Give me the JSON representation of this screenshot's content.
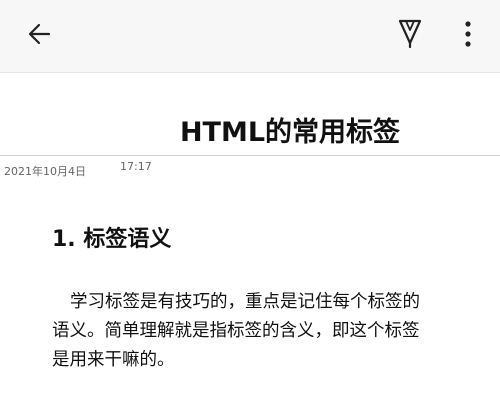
{
  "toolbar": {
    "back_icon": "arrow-left-icon",
    "pen_icon": "pen-icon",
    "more_icon": "more-vertical-icon"
  },
  "document": {
    "title": "HTML的常用标签",
    "date": "2021年10月4日",
    "time": "17:17",
    "section_heading": "1. 标签语义",
    "paragraph_lines": [
      "学习标签是有技巧的，重点是记住每个标签的",
      "语义。简单理解就是指标签的含义，即这个标签",
      "是用来干嘛的。"
    ]
  },
  "colors": {
    "toolbar_bg": "#f7f7f7",
    "text": "#111111",
    "meta_text": "#666666",
    "rule": "#cfcfcf"
  }
}
